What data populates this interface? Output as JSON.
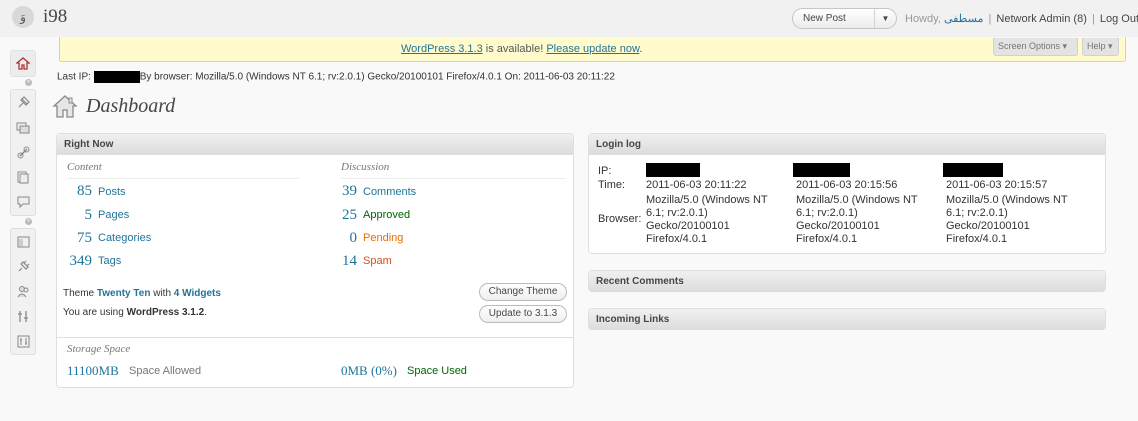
{
  "header": {
    "site_title": "i98",
    "logo_glyph": "وَ",
    "favorite_actions": {
      "label": "New Post",
      "arrow": "▼"
    },
    "user": {
      "howdy": "Howdy,",
      "username": "مسطفی",
      "network_admin": "Network Admin (8)",
      "separator": "|",
      "logout": "Log Out"
    }
  },
  "update_nag": {
    "link_text": "WordPress 3.1.3",
    "middle_text": " is available! ",
    "update_link": "Please update now",
    "end": "."
  },
  "screen_meta": {
    "screen_options": "Screen Options ▾",
    "help": "Help ▾"
  },
  "admin_menu": {
    "icons": [
      "dashboard-icon",
      "posts-icon",
      "media-icon",
      "links-icon",
      "pages-icon",
      "comments-icon",
      "appearance-icon",
      "plugins-icon",
      "users-icon",
      "tools-icon",
      "settings-icon"
    ]
  },
  "last_ip": {
    "prefix": "Last IP:",
    "text": "By browser: Mozilla/5.0 (Windows NT 6.1; rv:2.0.1) Gecko/20100101 Firefox/4.0.1 On: 2011-06-03 20:11:22"
  },
  "page": {
    "title": "Dashboard"
  },
  "right_now": {
    "title": "Right Now",
    "content_label": "Content",
    "discussion_label": "Discussion",
    "content": [
      {
        "num": "85",
        "label": "Posts"
      },
      {
        "num": "5",
        "label": "Pages"
      },
      {
        "num": "75",
        "label": "Categories"
      },
      {
        "num": "349",
        "label": "Tags"
      }
    ],
    "discussion": [
      {
        "num": "39",
        "label": "Comments"
      },
      {
        "num": "25",
        "label": "Approved"
      },
      {
        "num": "0",
        "label": "Pending"
      },
      {
        "num": "14",
        "label": "Spam"
      }
    ],
    "theme": {
      "prefix": "Theme ",
      "name": "Twenty Ten",
      "with": " with ",
      "widgets": "4 Widgets"
    },
    "version": {
      "prefix": "You are using ",
      "version": "WordPress 3.1.2",
      "end": "."
    },
    "change_theme_button": "Change Theme",
    "update_button": "Update to 3.1.3",
    "storage": {
      "label": "Storage Space",
      "allowed_num": "11100MB",
      "allowed_label": "Space Allowed",
      "used_num": "0MB (0%)",
      "used_label": "Space Used"
    }
  },
  "login_log": {
    "title": "Login log",
    "ip_label": "IP:",
    "time_label": "Time:",
    "browser_label": "Browser:",
    "entries": [
      {
        "time": "2011-06-03 20:11:22",
        "browser": [
          "Mozilla/5.0 (Windows NT",
          "6.1; rv:2.0.1)",
          "Gecko/20100101",
          "Firefox/4.0.1"
        ]
      },
      {
        "time": "2011-06-03 20:15:56",
        "browser": [
          "Mozilla/5.0 (Windows NT",
          "6.1; rv:2.0.1)",
          "Gecko/20100101",
          "Firefox/4.0.1"
        ]
      },
      {
        "time": "2011-06-03 20:15:57",
        "browser": [
          "Mozilla/5.0 (Windows NT",
          "6.1; rv:2.0.1)",
          "Gecko/20100101",
          "Firefox/4.0.1"
        ]
      }
    ]
  },
  "recent_comments": {
    "title": "Recent Comments"
  },
  "incoming_links": {
    "title": "Incoming Links"
  }
}
